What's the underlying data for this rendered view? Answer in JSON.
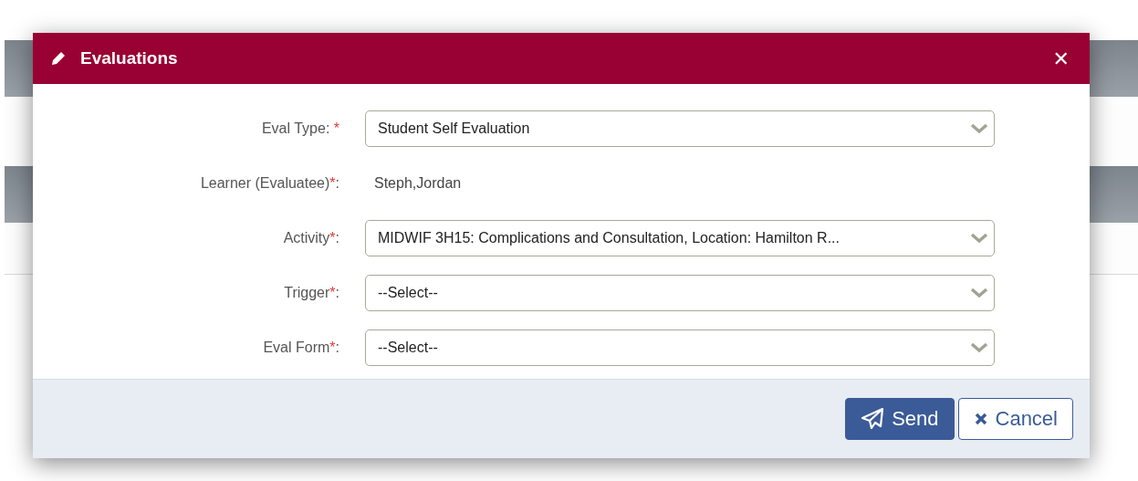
{
  "dialog": {
    "title": "Evaluations",
    "close": "✕"
  },
  "fields": [
    {
      "kind": "select",
      "label": "Eval Type: ",
      "required_mark": "*",
      "value": "Student Self Evaluation"
    },
    {
      "kind": "text",
      "label": "Learner (Evaluatee)",
      "required_mark": "*",
      "suffix": ":",
      "value": "Steph,Jordan"
    },
    {
      "kind": "select",
      "label": "Activity",
      "required_mark": "*",
      "suffix": ":",
      "value": "MIDWIF 3H15: Complications and Consultation, Location: Hamilton R..."
    },
    {
      "kind": "select",
      "label": "Trigger",
      "required_mark": "*",
      "suffix": ":",
      "value": "--Select--"
    },
    {
      "kind": "select",
      "label": "Eval Form",
      "required_mark": "*",
      "suffix": ":",
      "value": "--Select--"
    }
  ],
  "buttons": [
    {
      "kind": "primary",
      "label": "Send"
    },
    {
      "kind": "secondary",
      "label": "Cancel"
    }
  ]
}
